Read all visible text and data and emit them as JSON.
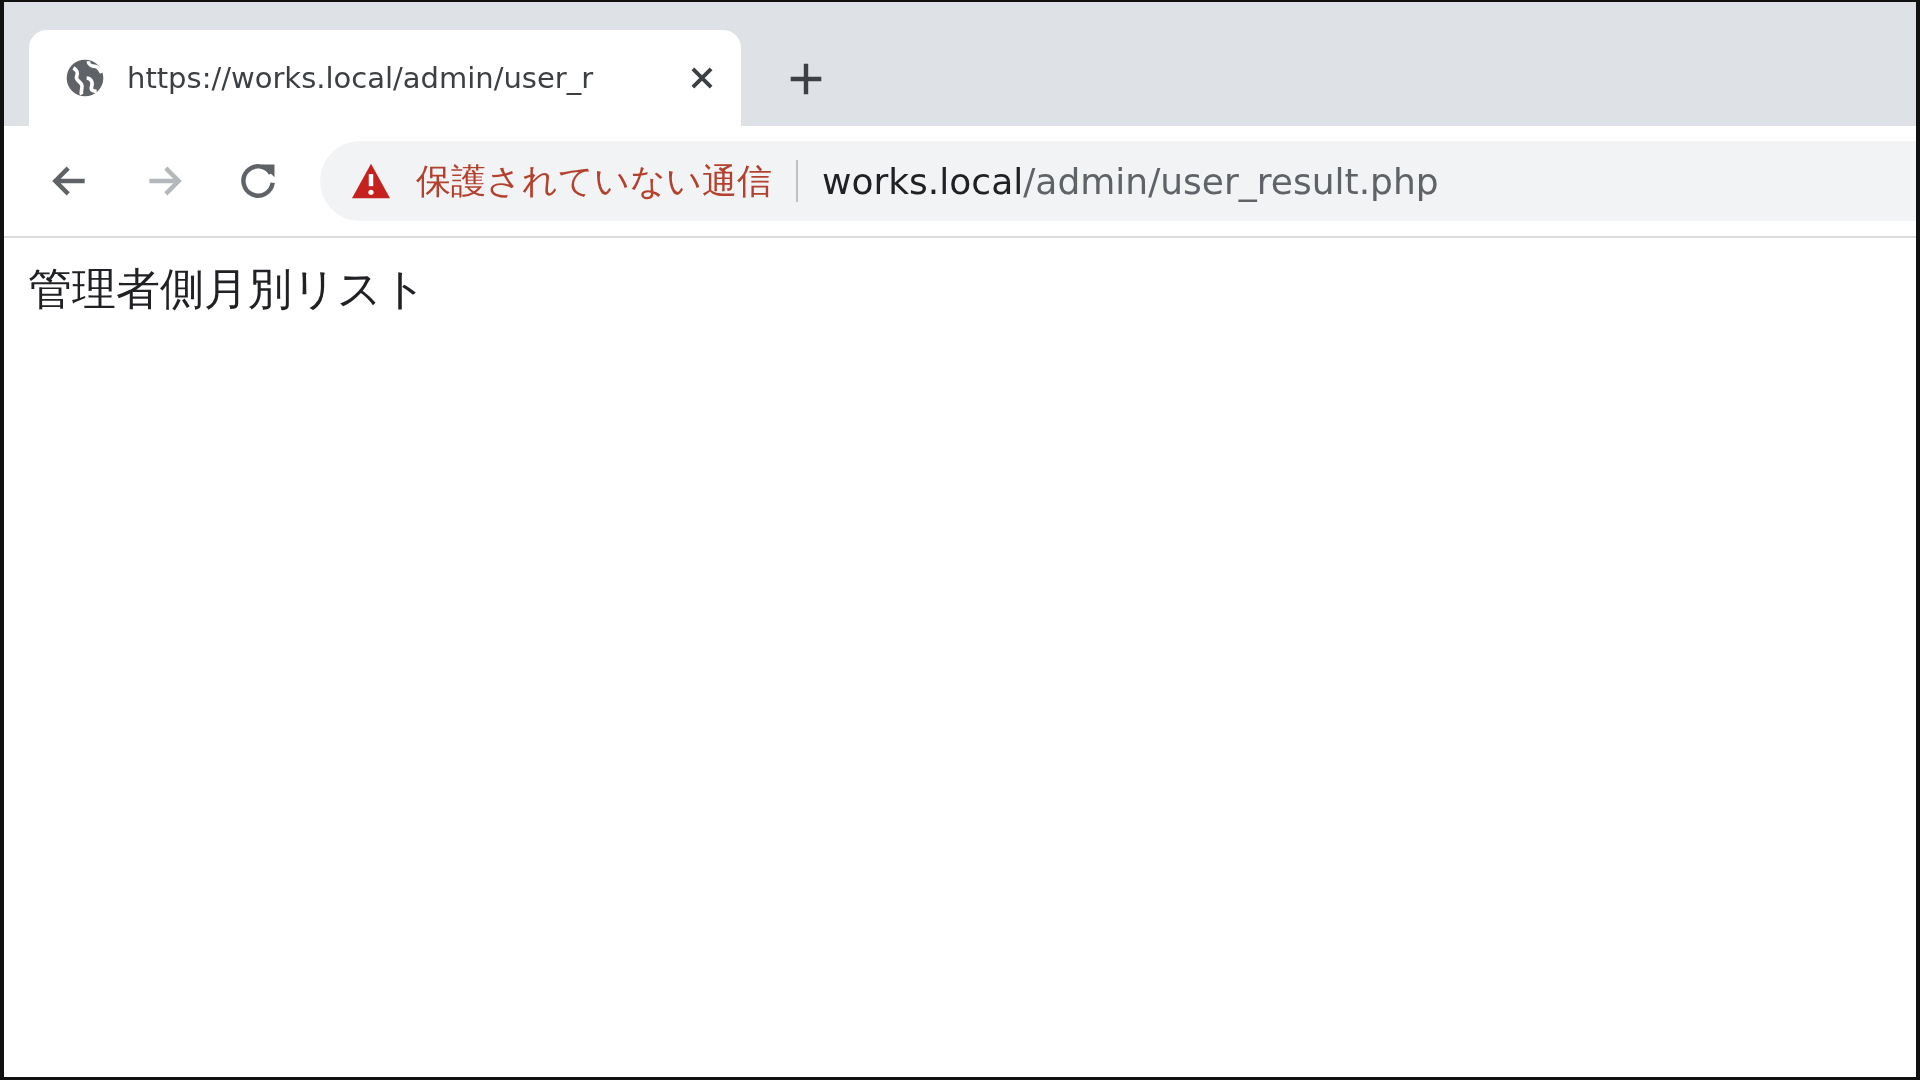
{
  "tabs": [
    {
      "title": "https://works.local/admin/user_r",
      "selected": true
    }
  ],
  "toolbar": {
    "forward_disabled": true
  },
  "address_bar": {
    "security_label": "保護されていない通信",
    "host": "works.local",
    "path": "/admin/user_result.php"
  },
  "page": {
    "heading": "管理者側月別リスト"
  }
}
